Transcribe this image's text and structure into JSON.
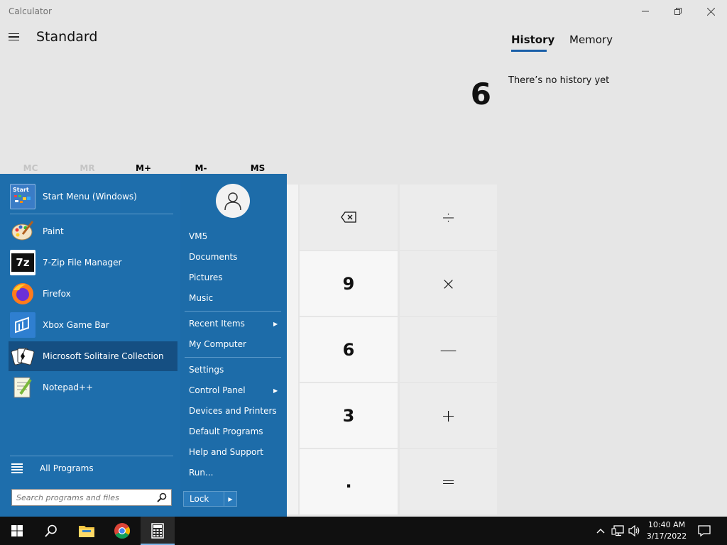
{
  "window": {
    "title": "Calculator"
  },
  "calculator": {
    "mode": "Standard",
    "display": "6",
    "memory_buttons": [
      {
        "label": "MC",
        "enabled": false
      },
      {
        "label": "MR",
        "enabled": false
      },
      {
        "label": "M+",
        "enabled": true
      },
      {
        "label": "M-",
        "enabled": true
      },
      {
        "label": "MS",
        "enabled": true
      }
    ],
    "keys": {
      "backspace": "⌫",
      "divide": "÷",
      "nine": "9",
      "multiply": "×",
      "six": "6",
      "minus": "—",
      "three": "3",
      "plus": "+",
      "decimal": ".",
      "equals": "="
    }
  },
  "history_panel": {
    "tabs": [
      {
        "label": "History",
        "active": true
      },
      {
        "label": "Memory",
        "active": false
      }
    ],
    "empty_message": "There’s no history yet"
  },
  "start_menu": {
    "pinned": [
      {
        "label": "Start Menu (Windows)",
        "icon": "start-menu-icon"
      },
      {
        "label": "Paint",
        "icon": "paint-icon"
      },
      {
        "label": "7-Zip File Manager",
        "icon": "7zip-icon"
      },
      {
        "label": "Firefox",
        "icon": "firefox-icon"
      },
      {
        "label": "Xbox Game Bar",
        "icon": "xbox-game-bar-icon"
      },
      {
        "label": "Microsoft Solitaire Collection",
        "icon": "solitaire-icon",
        "highlighted": true
      },
      {
        "label": "Notepad++",
        "icon": "notepadpp-icon"
      }
    ],
    "start_icon_text": "Start",
    "sevenzip_icon_text": "7z",
    "all_programs": "All Programs",
    "search_placeholder": "Search programs and files",
    "right_links": [
      {
        "label": "VM5"
      },
      {
        "label": "Documents"
      },
      {
        "label": "Pictures"
      },
      {
        "label": "Music"
      },
      {
        "label": "Recent Items",
        "submenu": true
      },
      {
        "label": "My Computer"
      },
      {
        "label": "Settings"
      },
      {
        "label": "Control Panel",
        "submenu": true
      },
      {
        "label": "Devices and Printers"
      },
      {
        "label": "Default Programs"
      },
      {
        "label": "Help and Support"
      },
      {
        "label": "Run..."
      }
    ],
    "lock_label": "Lock"
  },
  "taskbar": {
    "time": "10:40 AM",
    "date": "3/17/2022"
  }
}
